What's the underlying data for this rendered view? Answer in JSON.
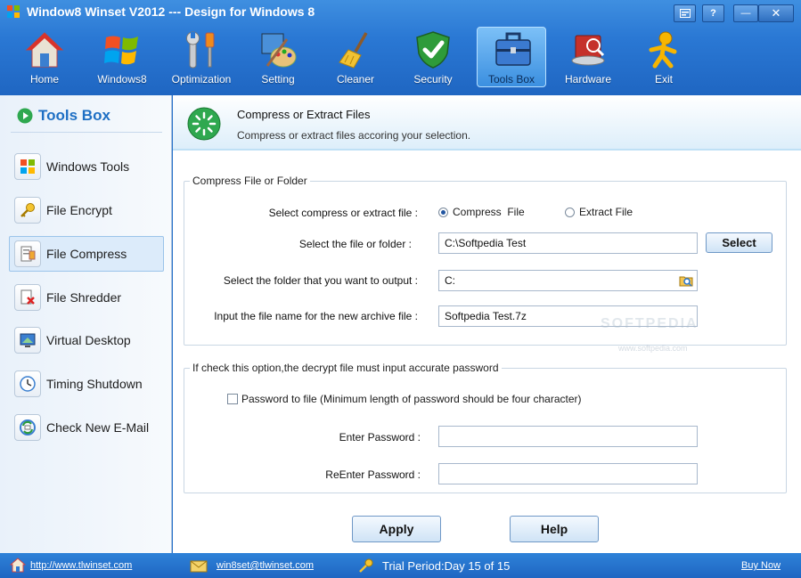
{
  "window": {
    "title": "Window8 Winset V2012 --- Design for Windows 8"
  },
  "toolbar": {
    "items": [
      {
        "label": "Home",
        "icon": "home-icon"
      },
      {
        "label": "Windows8",
        "icon": "windows-logo-icon"
      },
      {
        "label": "Optimization",
        "icon": "wrench-screwdriver-icon"
      },
      {
        "label": "Setting",
        "icon": "paint-palette-icon"
      },
      {
        "label": "Cleaner",
        "icon": "broom-icon"
      },
      {
        "label": "Security",
        "icon": "shield-check-icon"
      },
      {
        "label": "Tools Box",
        "icon": "toolbox-icon",
        "active": true
      },
      {
        "label": "Hardware",
        "icon": "hard-drive-icon"
      },
      {
        "label": "Exit",
        "icon": "running-man-icon"
      }
    ]
  },
  "sidebar": {
    "title": "Tools Box",
    "items": [
      {
        "label": "Windows Tools",
        "icon": "windows-tools-icon"
      },
      {
        "label": "File Encrypt",
        "icon": "key-icon"
      },
      {
        "label": "File Compress",
        "icon": "compress-icon",
        "active": true
      },
      {
        "label": "File Shredder",
        "icon": "shredder-icon"
      },
      {
        "label": "Virtual Desktop",
        "icon": "virtual-desktop-icon"
      },
      {
        "label": "Timing Shutdown",
        "icon": "clock-icon"
      },
      {
        "label": "Check New E-Mail",
        "icon": "email-check-icon"
      }
    ]
  },
  "header": {
    "title": "Compress or Extract Files",
    "subtitle": "Compress or extract files accoring your selection."
  },
  "compress_group": {
    "legend": "Compress File or Folder",
    "mode_label": "Select compress or extract file :",
    "mode_options": [
      "Compress  File",
      "Extract File"
    ],
    "selected_mode": "Compress  File",
    "file_label": "Select the file or folder :",
    "file_value": "C:\\Softpedia Test",
    "select_button": "Select",
    "output_label": "Select the folder that you want to output :",
    "output_value": "C:",
    "archive_label": "Input the file name for the new archive file :",
    "archive_value": "Softpedia Test.7z"
  },
  "password_group": {
    "legend": "If check this option,the decrypt file must input accurate password",
    "checkbox_label": "Password to file (Minimum length of password should be four character)",
    "checked": false,
    "enter_label": "Enter Password :",
    "reenter_label": "ReEnter Password :",
    "enter_value": "",
    "reenter_value": ""
  },
  "actions": {
    "apply": "Apply",
    "help": "Help"
  },
  "watermark": {
    "text": "SOFTPEDIA",
    "sub": "www.softpedia.com"
  },
  "statusbar": {
    "website": "http://www.tlwinset.com",
    "email": "win8set@tlwinset.com",
    "trial": "Trial Period:Day 15 of 15",
    "buy": "Buy Now"
  },
  "colors": {
    "accent": "#2a78d4",
    "sidebar_title": "#1e6fc4",
    "active_item_bg": "#dcebfa"
  }
}
